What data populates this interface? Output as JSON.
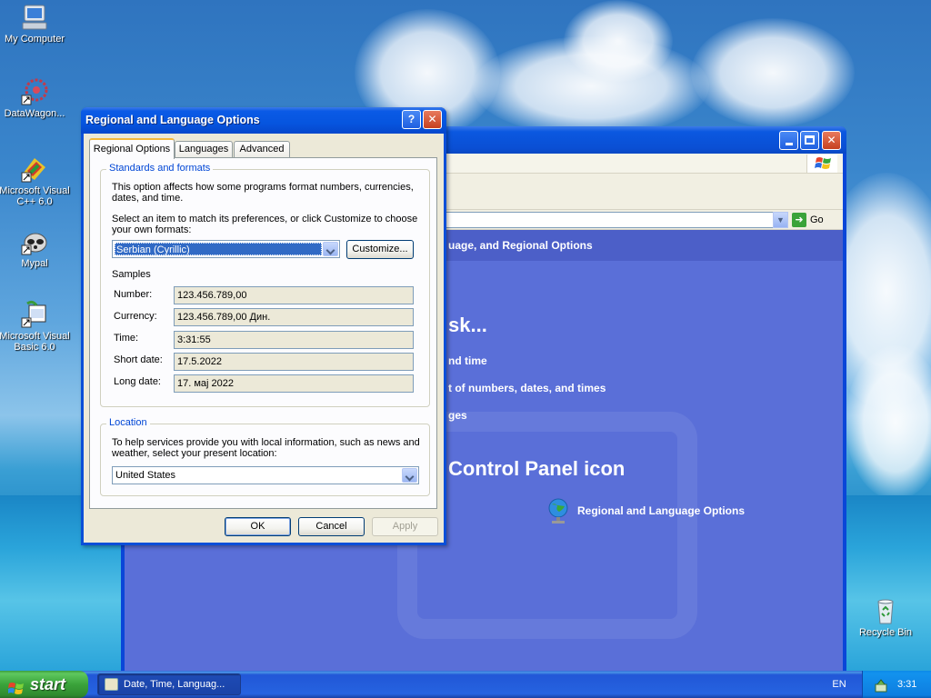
{
  "desktop": {
    "icons": [
      {
        "label": "My Computer"
      },
      {
        "label": "DataWagon..."
      },
      {
        "label": "Microsoft Visual C++ 6.0"
      },
      {
        "label": "Mypal"
      },
      {
        "label": "Microsoft Visual Basic 6.0"
      },
      {
        "label": "Recycle Bin"
      }
    ]
  },
  "explorer": {
    "go_label": "Go",
    "header_text": "uage, and Regional Options",
    "task_heading": "sk...",
    "task_items": [
      "nd time",
      "t of numbers, dates, and times",
      "ges"
    ],
    "icon_heading": "Control Panel icon",
    "icon_item": "Regional and Language Options"
  },
  "dialog": {
    "title": "Regional and Language Options",
    "help_button": "?",
    "close_button": "✕",
    "tabs": [
      {
        "label": "Regional Options",
        "active": true
      },
      {
        "label": "Languages",
        "active": false
      },
      {
        "label": "Advanced",
        "active": false
      }
    ],
    "standards": {
      "group_title": "Standards and formats",
      "description": "This option affects how some programs format numbers, currencies, dates, and time.",
      "instruction": "Select an item to match its preferences, or click Customize to choose your own formats:",
      "selected_format": "Serbian (Cyrillic)",
      "customize_label": "Customize...",
      "samples_heading": "Samples",
      "samples": [
        {
          "label": "Number:",
          "value": "123.456.789,00"
        },
        {
          "label": "Currency:",
          "value": "123.456.789,00 Дин."
        },
        {
          "label": "Time:",
          "value": "3:31:55"
        },
        {
          "label": "Short date:",
          "value": "17.5.2022"
        },
        {
          "label": "Long date:",
          "value": "17. мај 2022"
        }
      ]
    },
    "location": {
      "group_title": "Location",
      "description": "To help services provide you with local information, such as news and weather, select your present location:",
      "selected_location": "United States"
    },
    "buttons": {
      "ok": "OK",
      "cancel": "Cancel",
      "apply": "Apply"
    }
  },
  "taskbar": {
    "start_label": "start",
    "task_button": "Date, Time, Languag...",
    "language": "EN",
    "clock": "3:31"
  }
}
